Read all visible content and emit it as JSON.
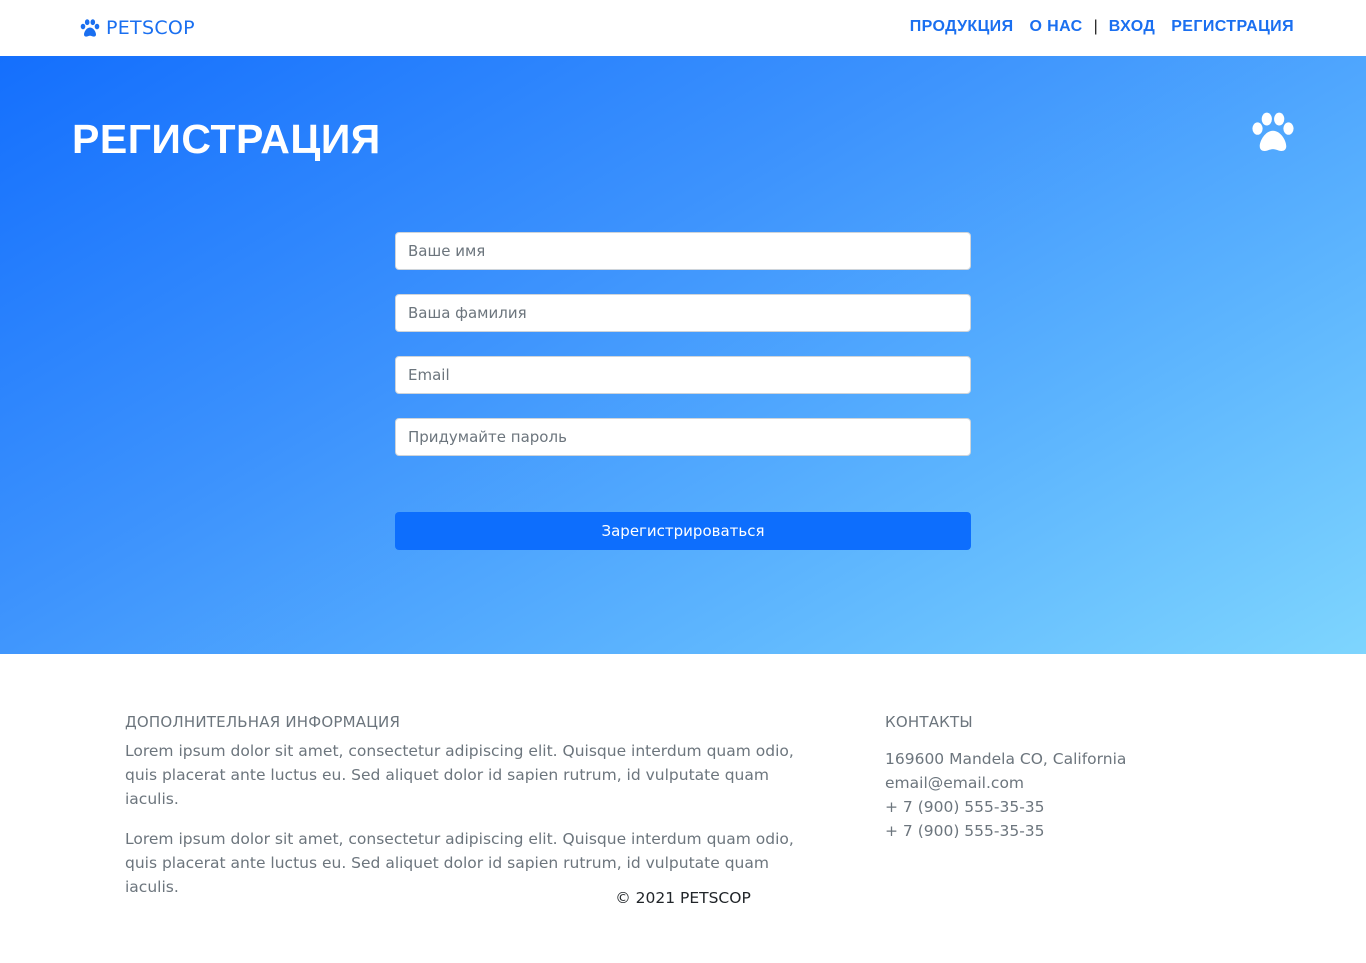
{
  "navbar": {
    "brand": "PETSCOP",
    "brand_icon": "paw-icon",
    "links": {
      "products": "ПРОДУКЦИЯ",
      "about": "О НАС",
      "separator": "|",
      "login": "ВХОД",
      "register": "РЕГИСТРАЦИЯ"
    }
  },
  "hero": {
    "title": "РЕГИСТРАЦИЯ",
    "icon": "paw-icon",
    "gradient": [
      "#146ffd",
      "#7ed5fe"
    ]
  },
  "form": {
    "first_name_placeholder": "Ваше имя",
    "last_name_placeholder": "Ваша фамилия",
    "email_placeholder": "Email",
    "password_placeholder": "Придумайте пароль",
    "submit_label": "Зарегистрироваться"
  },
  "footer": {
    "info_heading": "ДОПОЛНИТЕЛЬНАЯ ИНФОРМАЦИЯ",
    "paragraphs": [
      "Lorem ipsum dolor sit amet, consectetur adipiscing elit. Quisque interdum quam odio, quis placerat ante luctus eu. Sed aliquet dolor id sapien rutrum, id vulputate quam iaculis.",
      "Lorem ipsum dolor sit amet, consectetur adipiscing elit. Quisque interdum quam odio, quis placerat ante luctus eu. Sed aliquet dolor id sapien rutrum, id vulputate quam iaculis."
    ],
    "contacts_heading": "КОНТАКТЫ",
    "contacts": [
      "169600 Mandela CO, California",
      "email@email.com",
      "+ 7 (900) 555-35-35",
      "+ 7 (900) 555-35-35"
    ],
    "copyright": "© 2021 PETSCOP"
  },
  "colors": {
    "accent": "#1a6ff0",
    "button": "#0d6efd",
    "muted_text": "#6c757d"
  }
}
